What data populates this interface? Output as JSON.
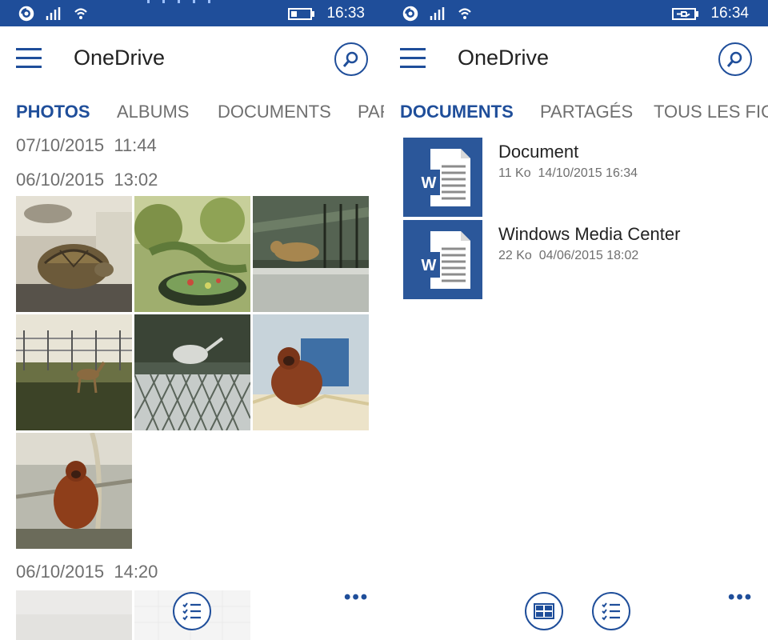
{
  "status_bars": [
    {
      "time": "16:33",
      "battery": "battery-low-icon"
    },
    {
      "time": "16:34",
      "battery": "battery-charging-icon"
    }
  ],
  "left_screen": {
    "app_title": "OneDrive",
    "tabs": [
      {
        "label": "PHOTOS",
        "active": true
      },
      {
        "label": "ALBUMS",
        "active": false
      },
      {
        "label": "DOCUMENTS",
        "active": false
      },
      {
        "label": "PARTAGÉS",
        "active": false
      }
    ],
    "groups": [
      {
        "date": "07/10/2015",
        "time": "11:44"
      },
      {
        "date": "06/10/2015",
        "time": "13:02"
      },
      {
        "date": "06/10/2015",
        "time": "14:20"
      }
    ],
    "photos": [
      {
        "subject": "tortoise"
      },
      {
        "subject": "iguana"
      },
      {
        "subject": "jaguar"
      },
      {
        "subject": "deer"
      },
      {
        "subject": "bird-behind-fence"
      },
      {
        "subject": "orangutan-in-straw"
      },
      {
        "subject": "orangutan-on-rope"
      }
    ],
    "more": "•••"
  },
  "right_screen": {
    "app_title": "OneDrive",
    "tabs": [
      {
        "label": "DOCUMENTS",
        "active": true
      },
      {
        "label": "PARTAGÉS",
        "active": false
      },
      {
        "label": "TOUS LES FICHIERS",
        "active": false
      }
    ],
    "documents": [
      {
        "name": "Document",
        "size": "11 Ko",
        "modified": "14/10/2015 16:34",
        "icon": "word-document-icon"
      },
      {
        "name": "Windows Media Center",
        "size": "22 Ko",
        "modified": "04/06/2015 18:02",
        "icon": "word-document-icon"
      }
    ],
    "more": "•••"
  },
  "colors": {
    "accent": "#1f4e9a",
    "word_blue": "#2b579a"
  }
}
